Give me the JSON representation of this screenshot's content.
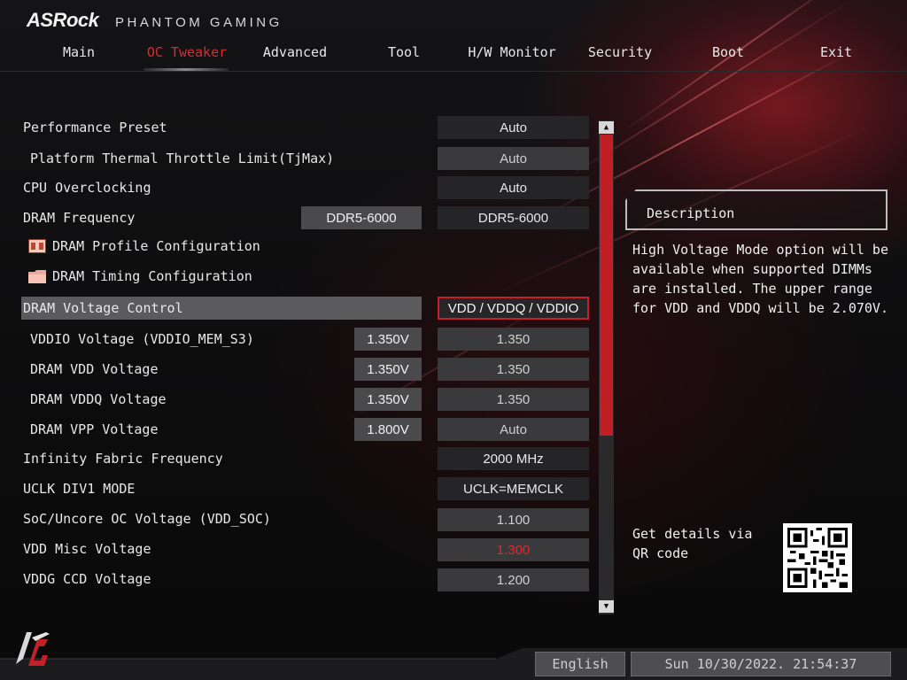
{
  "brand": {
    "name": "ASRock",
    "subtitle": "PHANTOM GAMING"
  },
  "nav": [
    {
      "label": "Main",
      "active": false
    },
    {
      "label": "OC Tweaker",
      "active": true
    },
    {
      "label": "Advanced",
      "active": false
    },
    {
      "label": "Tool",
      "active": false
    },
    {
      "label": "H/W Monitor",
      "active": false
    },
    {
      "label": "Security",
      "active": false
    },
    {
      "label": "Boot",
      "active": false
    },
    {
      "label": "Exit",
      "active": false
    }
  ],
  "settings": [
    {
      "label": "Performance Preset",
      "value": "Auto"
    },
    {
      "label": "Platform Thermal Throttle Limit(TjMax)",
      "value": "Auto"
    },
    {
      "label": "CPU Overclocking",
      "value": "Auto"
    },
    {
      "label": "DRAM Frequency",
      "current": "DDR5-6000",
      "value": "DDR5-6000"
    },
    {
      "label": "DRAM Profile Configuration",
      "icon": "memory-icon"
    },
    {
      "label": "DRAM Timing Configuration",
      "icon": "folder-icon"
    },
    {
      "label": "DRAM Voltage Control",
      "value": "VDD / VDDQ / VDDIO"
    },
    {
      "label": "VDDIO Voltage (VDDIO_MEM_S3)",
      "current": "1.350V",
      "value": "1.350"
    },
    {
      "label": "DRAM VDD Voltage",
      "current": "1.350V",
      "value": "1.350"
    },
    {
      "label": "DRAM VDDQ Voltage",
      "current": "1.350V",
      "value": "1.350"
    },
    {
      "label": "DRAM VPP Voltage",
      "current": "1.800V",
      "value": "Auto"
    },
    {
      "label": "Infinity Fabric Frequency",
      "value": "2000 MHz"
    },
    {
      "label": "UCLK DIV1 MODE",
      "value": "UCLK=MEMCLK"
    },
    {
      "label": "SoC/Uncore OC Voltage (VDD_SOC)",
      "value": "1.100"
    },
    {
      "label": "VDD Misc Voltage",
      "value": "1.300"
    },
    {
      "label": "VDDG CCD Voltage",
      "value": "1.200"
    }
  ],
  "description": {
    "title": "Description",
    "text": "High Voltage Mode option will be\navailable when supported DIMMs\nare installed. The upper range\nfor VDD and VDDQ will be 2.070V."
  },
  "qr": {
    "text": "Get details via QR code"
  },
  "footer": {
    "language": "English",
    "datetime": "Sun 10/30/2022. 21:54:37"
  },
  "colors": {
    "accent": "#c42027",
    "warning": "#e0282e"
  }
}
